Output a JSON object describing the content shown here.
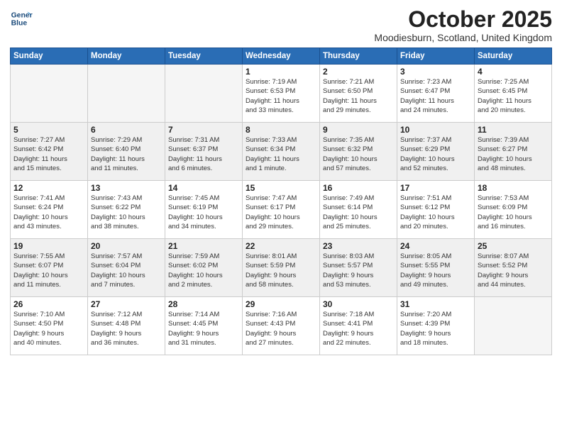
{
  "header": {
    "logo_line1": "General",
    "logo_line2": "Blue",
    "month": "October 2025",
    "location": "Moodiesburn, Scotland, United Kingdom"
  },
  "days_of_week": [
    "Sunday",
    "Monday",
    "Tuesday",
    "Wednesday",
    "Thursday",
    "Friday",
    "Saturday"
  ],
  "weeks": [
    [
      {
        "day": "",
        "info": ""
      },
      {
        "day": "",
        "info": ""
      },
      {
        "day": "",
        "info": ""
      },
      {
        "day": "1",
        "info": "Sunrise: 7:19 AM\nSunset: 6:53 PM\nDaylight: 11 hours\nand 33 minutes."
      },
      {
        "day": "2",
        "info": "Sunrise: 7:21 AM\nSunset: 6:50 PM\nDaylight: 11 hours\nand 29 minutes."
      },
      {
        "day": "3",
        "info": "Sunrise: 7:23 AM\nSunset: 6:47 PM\nDaylight: 11 hours\nand 24 minutes."
      },
      {
        "day": "4",
        "info": "Sunrise: 7:25 AM\nSunset: 6:45 PM\nDaylight: 11 hours\nand 20 minutes."
      }
    ],
    [
      {
        "day": "5",
        "info": "Sunrise: 7:27 AM\nSunset: 6:42 PM\nDaylight: 11 hours\nand 15 minutes."
      },
      {
        "day": "6",
        "info": "Sunrise: 7:29 AM\nSunset: 6:40 PM\nDaylight: 11 hours\nand 11 minutes."
      },
      {
        "day": "7",
        "info": "Sunrise: 7:31 AM\nSunset: 6:37 PM\nDaylight: 11 hours\nand 6 minutes."
      },
      {
        "day": "8",
        "info": "Sunrise: 7:33 AM\nSunset: 6:34 PM\nDaylight: 11 hours\nand 1 minute."
      },
      {
        "day": "9",
        "info": "Sunrise: 7:35 AM\nSunset: 6:32 PM\nDaylight: 10 hours\nand 57 minutes."
      },
      {
        "day": "10",
        "info": "Sunrise: 7:37 AM\nSunset: 6:29 PM\nDaylight: 10 hours\nand 52 minutes."
      },
      {
        "day": "11",
        "info": "Sunrise: 7:39 AM\nSunset: 6:27 PM\nDaylight: 10 hours\nand 48 minutes."
      }
    ],
    [
      {
        "day": "12",
        "info": "Sunrise: 7:41 AM\nSunset: 6:24 PM\nDaylight: 10 hours\nand 43 minutes."
      },
      {
        "day": "13",
        "info": "Sunrise: 7:43 AM\nSunset: 6:22 PM\nDaylight: 10 hours\nand 38 minutes."
      },
      {
        "day": "14",
        "info": "Sunrise: 7:45 AM\nSunset: 6:19 PM\nDaylight: 10 hours\nand 34 minutes."
      },
      {
        "day": "15",
        "info": "Sunrise: 7:47 AM\nSunset: 6:17 PM\nDaylight: 10 hours\nand 29 minutes."
      },
      {
        "day": "16",
        "info": "Sunrise: 7:49 AM\nSunset: 6:14 PM\nDaylight: 10 hours\nand 25 minutes."
      },
      {
        "day": "17",
        "info": "Sunrise: 7:51 AM\nSunset: 6:12 PM\nDaylight: 10 hours\nand 20 minutes."
      },
      {
        "day": "18",
        "info": "Sunrise: 7:53 AM\nSunset: 6:09 PM\nDaylight: 10 hours\nand 16 minutes."
      }
    ],
    [
      {
        "day": "19",
        "info": "Sunrise: 7:55 AM\nSunset: 6:07 PM\nDaylight: 10 hours\nand 11 minutes."
      },
      {
        "day": "20",
        "info": "Sunrise: 7:57 AM\nSunset: 6:04 PM\nDaylight: 10 hours\nand 7 minutes."
      },
      {
        "day": "21",
        "info": "Sunrise: 7:59 AM\nSunset: 6:02 PM\nDaylight: 10 hours\nand 2 minutes."
      },
      {
        "day": "22",
        "info": "Sunrise: 8:01 AM\nSunset: 5:59 PM\nDaylight: 9 hours\nand 58 minutes."
      },
      {
        "day": "23",
        "info": "Sunrise: 8:03 AM\nSunset: 5:57 PM\nDaylight: 9 hours\nand 53 minutes."
      },
      {
        "day": "24",
        "info": "Sunrise: 8:05 AM\nSunset: 5:55 PM\nDaylight: 9 hours\nand 49 minutes."
      },
      {
        "day": "25",
        "info": "Sunrise: 8:07 AM\nSunset: 5:52 PM\nDaylight: 9 hours\nand 44 minutes."
      }
    ],
    [
      {
        "day": "26",
        "info": "Sunrise: 7:10 AM\nSunset: 4:50 PM\nDaylight: 9 hours\nand 40 minutes."
      },
      {
        "day": "27",
        "info": "Sunrise: 7:12 AM\nSunset: 4:48 PM\nDaylight: 9 hours\nand 36 minutes."
      },
      {
        "day": "28",
        "info": "Sunrise: 7:14 AM\nSunset: 4:45 PM\nDaylight: 9 hours\nand 31 minutes."
      },
      {
        "day": "29",
        "info": "Sunrise: 7:16 AM\nSunset: 4:43 PM\nDaylight: 9 hours\nand 27 minutes."
      },
      {
        "day": "30",
        "info": "Sunrise: 7:18 AM\nSunset: 4:41 PM\nDaylight: 9 hours\nand 22 minutes."
      },
      {
        "day": "31",
        "info": "Sunrise: 7:20 AM\nSunset: 4:39 PM\nDaylight: 9 hours\nand 18 minutes."
      },
      {
        "day": "",
        "info": ""
      }
    ]
  ]
}
